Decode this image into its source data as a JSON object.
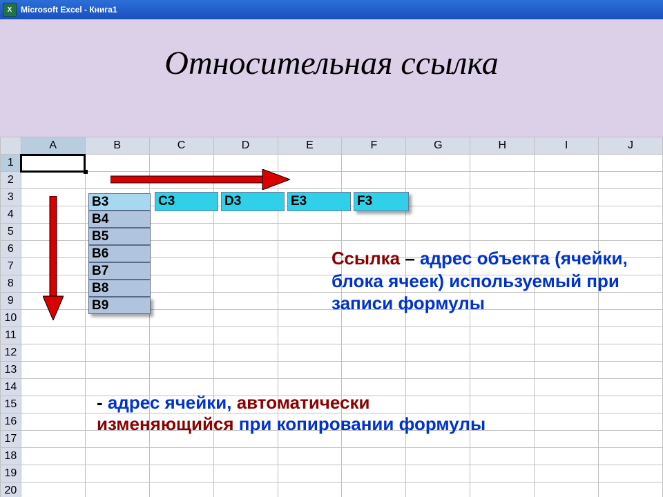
{
  "titlebar": {
    "app_name": "Microsoft Excel - Книга1",
    "icon_letter": "X"
  },
  "slide": {
    "title": "Относительная ссылка"
  },
  "grid": {
    "columns": [
      "A",
      "B",
      "C",
      "D",
      "E",
      "F",
      "G",
      "H",
      "I",
      "J"
    ],
    "row_count": 20
  },
  "overlay": {
    "col_cells": [
      "B3",
      "B4",
      "B5",
      "B6",
      "B7",
      "B8",
      "B9"
    ],
    "row_cells": [
      "C3",
      "D3",
      "E3",
      "F3"
    ]
  },
  "text1": {
    "w1": "Ссылка",
    "w2": " – ",
    "w3": "адрес объекта ",
    "w4": "(ячейки, блока ячеек) используемый при записи формулы"
  },
  "text2": {
    "dash": "- ",
    "w1": "адрес ячейки, ",
    "w2": "автоматически изменяющийся ",
    "w3": "при копировании формулы"
  }
}
